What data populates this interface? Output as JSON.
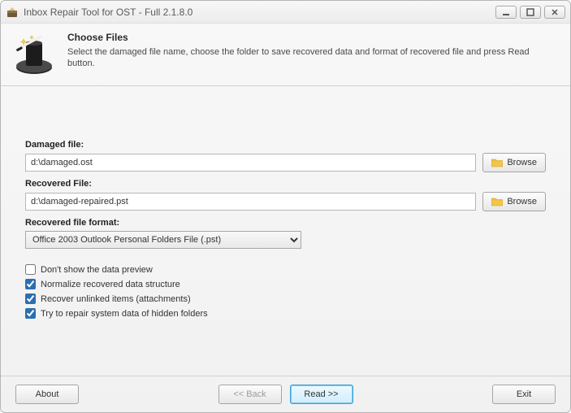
{
  "window": {
    "title": "Inbox Repair Tool for OST - Full 2.1.8.0"
  },
  "header": {
    "title": "Choose Files",
    "desc": "Select the damaged file name, choose the folder to save recovered data and format of recovered file and press Read button."
  },
  "fields": {
    "damaged_label": "Damaged file:",
    "damaged_value": "d:\\damaged.ost",
    "recovered_label": "Recovered File:",
    "recovered_value": "d:\\damaged-repaired.pst",
    "format_label": "Recovered file format:",
    "format_value": "Office 2003 Outlook Personal Folders File (.pst)"
  },
  "buttons": {
    "browse": "Browse",
    "about": "About",
    "back": "<< Back",
    "read": "Read >>",
    "exit": "Exit"
  },
  "options": {
    "o1": {
      "label": "Don't show the data preview",
      "checked": false
    },
    "o2": {
      "label": "Normalize recovered data structure",
      "checked": true
    },
    "o3": {
      "label": "Recover unlinked items (attachments)",
      "checked": true
    },
    "o4": {
      "label": "Try to repair system data of hidden folders",
      "checked": true
    }
  }
}
